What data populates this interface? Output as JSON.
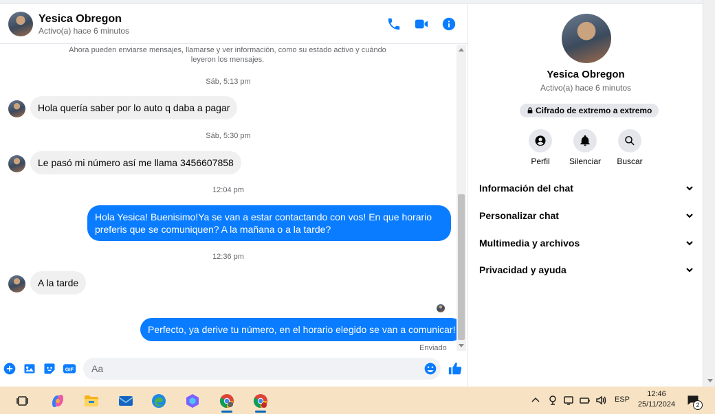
{
  "header": {
    "name": "Yesica Obregon",
    "status": "Activo(a) hace 6 minutos"
  },
  "conversation": {
    "intro": "Ahora pueden enviarse mensajes, llamarse y ver información, como su estado activo y cuándo leyeron los mensajes.",
    "timestamps": [
      "Sáb, 5:13 pm",
      "Sáb, 5:30 pm",
      "12:04 pm",
      "12:36 pm"
    ],
    "messages": [
      {
        "direction": "in",
        "text": "Hola quería saber por lo auto q daba a pagar"
      },
      {
        "direction": "in",
        "text": "Le pasó mi número así me llama 3456607858"
      },
      {
        "direction": "out",
        "text": "Hola Yesica! Buenisimo!Ya se van a estar contactando con vos! En que horario preferis que se comuniquen? A la mañana o a la tarde?"
      },
      {
        "direction": "in",
        "text": "A la tarde"
      },
      {
        "direction": "out",
        "text": "Perfecto, ya derive tu número, en el horario elegido se van a comunicar!"
      }
    ],
    "sent_label": "Enviado"
  },
  "composer": {
    "placeholder": "Aa"
  },
  "info": {
    "name": "Yesica Obregon",
    "status": "Activo(a) hace 6 minutos",
    "encryption": "Cifrado de extremo a extremo",
    "actions": [
      "Perfil",
      "Silenciar",
      "Buscar"
    ],
    "sections": [
      "Información del chat",
      "Personalizar chat",
      "Multimedia y archivos",
      "Privacidad y ayuda"
    ]
  },
  "taskbar": {
    "language": "ESP",
    "time": "12:46",
    "date": "25/11/2024",
    "notification_count": "2"
  },
  "colors": {
    "accent": "#0a7cff",
    "incoming_bubble": "#f0f0f0",
    "taskbar": "#f7e3c3"
  }
}
